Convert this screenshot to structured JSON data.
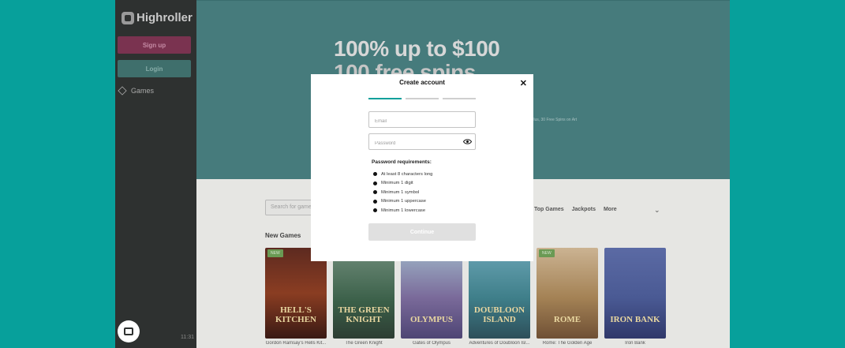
{
  "brand": {
    "name": "Highroller"
  },
  "sidebar": {
    "signup_label": "Sign up",
    "login_label": "Login",
    "games_label": "Games",
    "time": "11:31"
  },
  "hero": {
    "line1": "100% up to $100",
    "line2": "100 free spins",
    "small_text": "Plus, 30 Free Spins on Art"
  },
  "lobby": {
    "search_placeholder": "Search for games",
    "tabs": [
      "Top Games",
      "Jackpots",
      "More"
    ],
    "section_title": "New Games",
    "games": [
      {
        "name": "Gordon Ramsay's Hells Kit...",
        "art_text": "HELL'S KITCHEN",
        "badge": "NEW"
      },
      {
        "name": "The Green Knight",
        "art_text": "THE GREEN KNIGHT",
        "badge": ""
      },
      {
        "name": "Gates of Olympus",
        "art_text": "OLYMPUS",
        "badge": ""
      },
      {
        "name": "Adventures of Doubloon Isl...",
        "art_text": "DOUBLOON ISLAND",
        "badge": ""
      },
      {
        "name": "Rome: The Golden Age",
        "art_text": "ROME",
        "badge": "NEW"
      },
      {
        "name": "Iron Bank",
        "art_text": "IRON BANK",
        "badge": ""
      }
    ]
  },
  "modal": {
    "title": "Create account",
    "email_placeholder": "Email",
    "password_placeholder": "Password",
    "requirements_title": "Password requirements:",
    "requirements": [
      "At least 8 characters long",
      "Minimum 1 digit",
      "Minimum 1 symbol",
      "Minimum 1 uppercase",
      "Minimum 1 lowercase"
    ],
    "continue_label": "Continue"
  },
  "colors": {
    "accent": "#07a09b",
    "signup": "#7a3350",
    "sidebar": "#2e3130"
  }
}
